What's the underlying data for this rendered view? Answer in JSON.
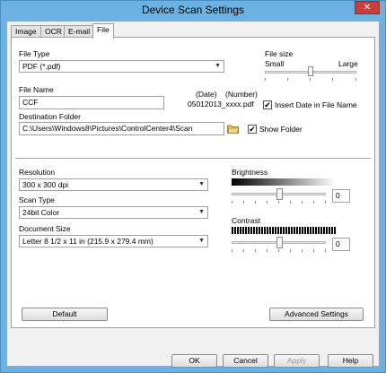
{
  "window": {
    "title": "Device Scan Settings",
    "close": "✕"
  },
  "tabs": [
    {
      "label": "Image"
    },
    {
      "label": "OCR"
    },
    {
      "label": "E-mail"
    },
    {
      "label": "File"
    }
  ],
  "file_type": {
    "label": "File Type",
    "value": "PDF (*.pdf)"
  },
  "file_size": {
    "label": "File size",
    "small": "Small",
    "large": "Large",
    "level": 0.5
  },
  "file_name": {
    "label": "File Name",
    "value": "CCF",
    "date_header": "(Date)",
    "number_header": "(Number)",
    "preview": "05012013_xxxx.pdf",
    "insert_date_label": "Insert Date in File Name",
    "insert_date_checked": true
  },
  "destination": {
    "label": "Destination Folder",
    "value": "C:\\Users\\Windows8\\Pictures\\ControlCenter4\\Scan",
    "show_folder_label": "Show Folder",
    "show_folder_checked": true
  },
  "resolution": {
    "label": "Resolution",
    "value": "300 x 300 dpi"
  },
  "scan_type": {
    "label": "Scan Type",
    "value": "24bit Color"
  },
  "document_size": {
    "label": "Document Size",
    "value": "Letter 8 1/2 x 11 in (215.9 x 279.4 mm)"
  },
  "brightness": {
    "label": "Brightness",
    "value": "0",
    "level": 0.5
  },
  "contrast": {
    "label": "Contrast",
    "value": "0",
    "level": 0.5
  },
  "buttons": {
    "default": "Default",
    "advanced": "Advanced Settings",
    "ok": "OK",
    "cancel": "Cancel",
    "apply": "Apply",
    "help": "Help"
  },
  "checkmark": "✔"
}
